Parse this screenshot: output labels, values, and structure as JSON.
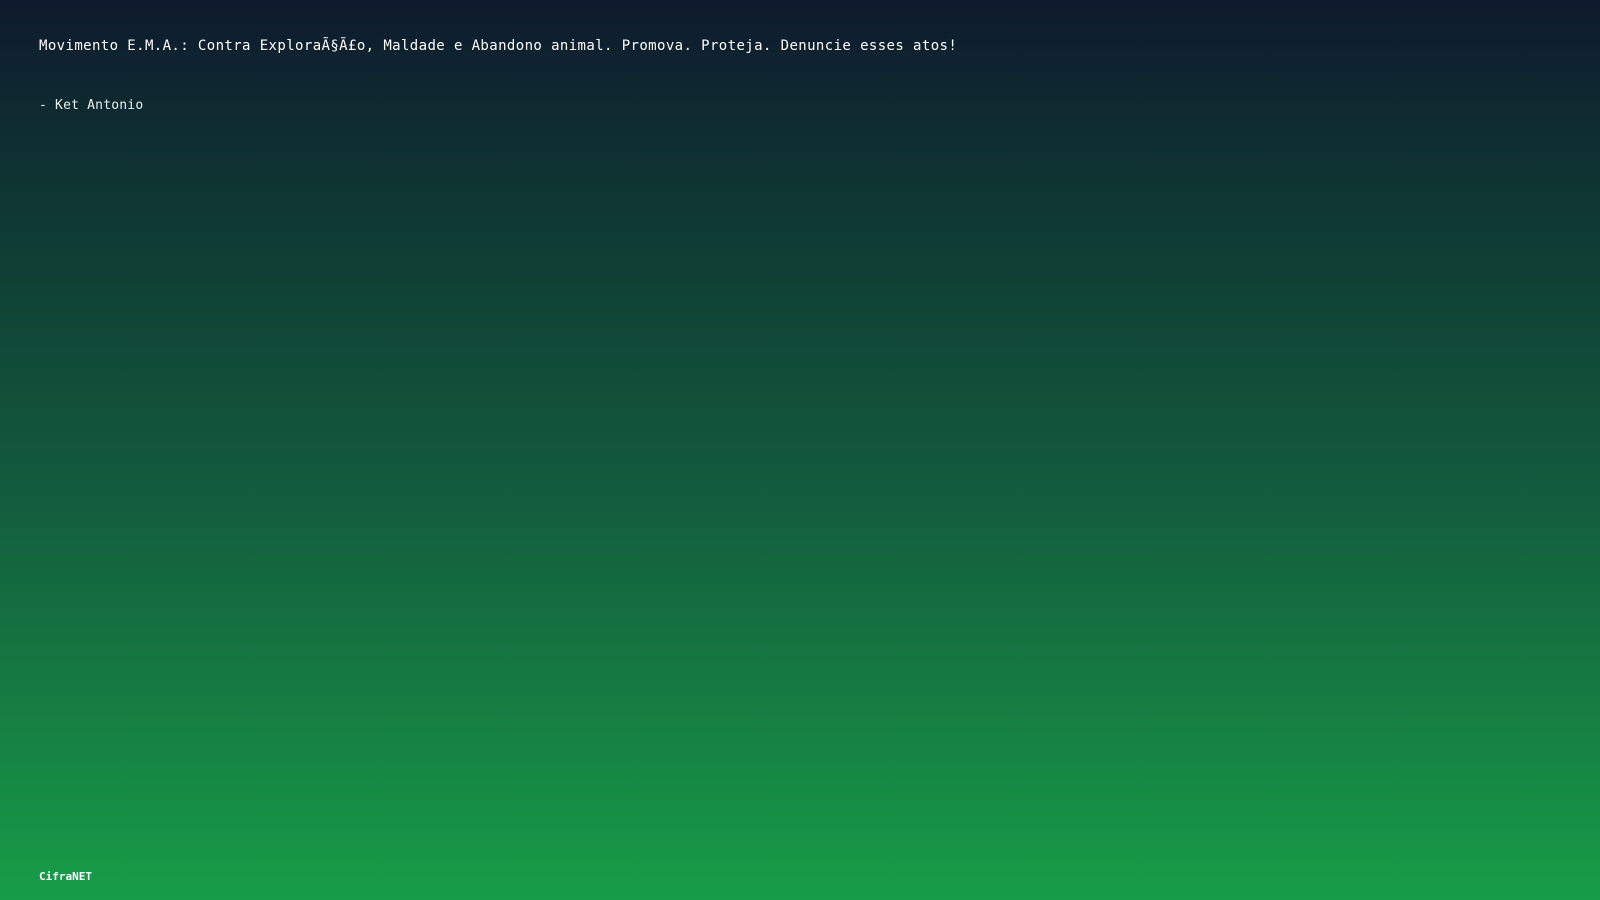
{
  "quote": {
    "text": "Movimento E.M.A.: Contra ExploraÃ§Ã£o, Maldade e Abandono animal. Promova. Proteja. Denuncie esses atos!",
    "author": "- Ket Antonio"
  },
  "footer": {
    "brand": "CifraNET"
  },
  "colors": {
    "gradient_top": "#0e1a2e",
    "gradient_bottom": "#179d48",
    "text": "#ffffff"
  }
}
